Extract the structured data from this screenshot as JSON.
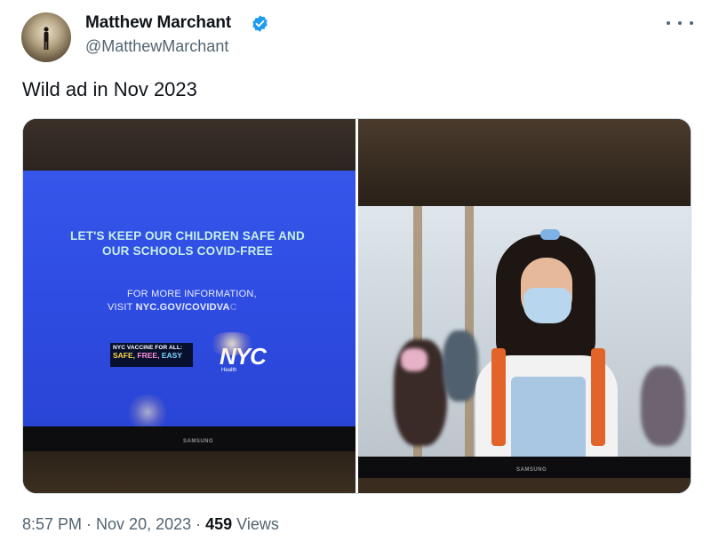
{
  "author": {
    "display_name": "Matthew Marchant",
    "handle": "@MatthewMarchant",
    "verified": true
  },
  "tweet": {
    "text": "Wild ad in Nov 2023"
  },
  "media": {
    "left_ad": {
      "headline_line1": "LET'S KEEP OUR CHILDREN SAFE AND",
      "headline_line2": "OUR SCHOOLS COVID-FREE",
      "info_line1": "FOR MORE INFORMATION,",
      "info_prefix": "VISIT ",
      "info_url": "NYC.GOV/COVIDVA",
      "info_url_faded": "C",
      "badge_title": "NYC VACCINE FOR ALL:",
      "badge_safe": "SAFE,",
      "badge_free": "FREE,",
      "badge_easy": "EASY",
      "logo": "NYC",
      "logo_sub": "Health",
      "tv_brand": "SAMSUNG"
    },
    "right_ad": {
      "tv_brand": "SAMSUNG"
    }
  },
  "footer": {
    "time": "8:57 PM",
    "separator": " · ",
    "date": "Nov 20, 2023",
    "views_count": "459",
    "views_label": " Views"
  },
  "colors": {
    "primary_text": "#0f1419",
    "secondary_text": "#536471",
    "verified_badge": "#1d9bf0",
    "ad_blue": "#2f4de3"
  },
  "icons": {
    "verified": "verified-badge-icon",
    "more": "more-horizontal-icon"
  }
}
